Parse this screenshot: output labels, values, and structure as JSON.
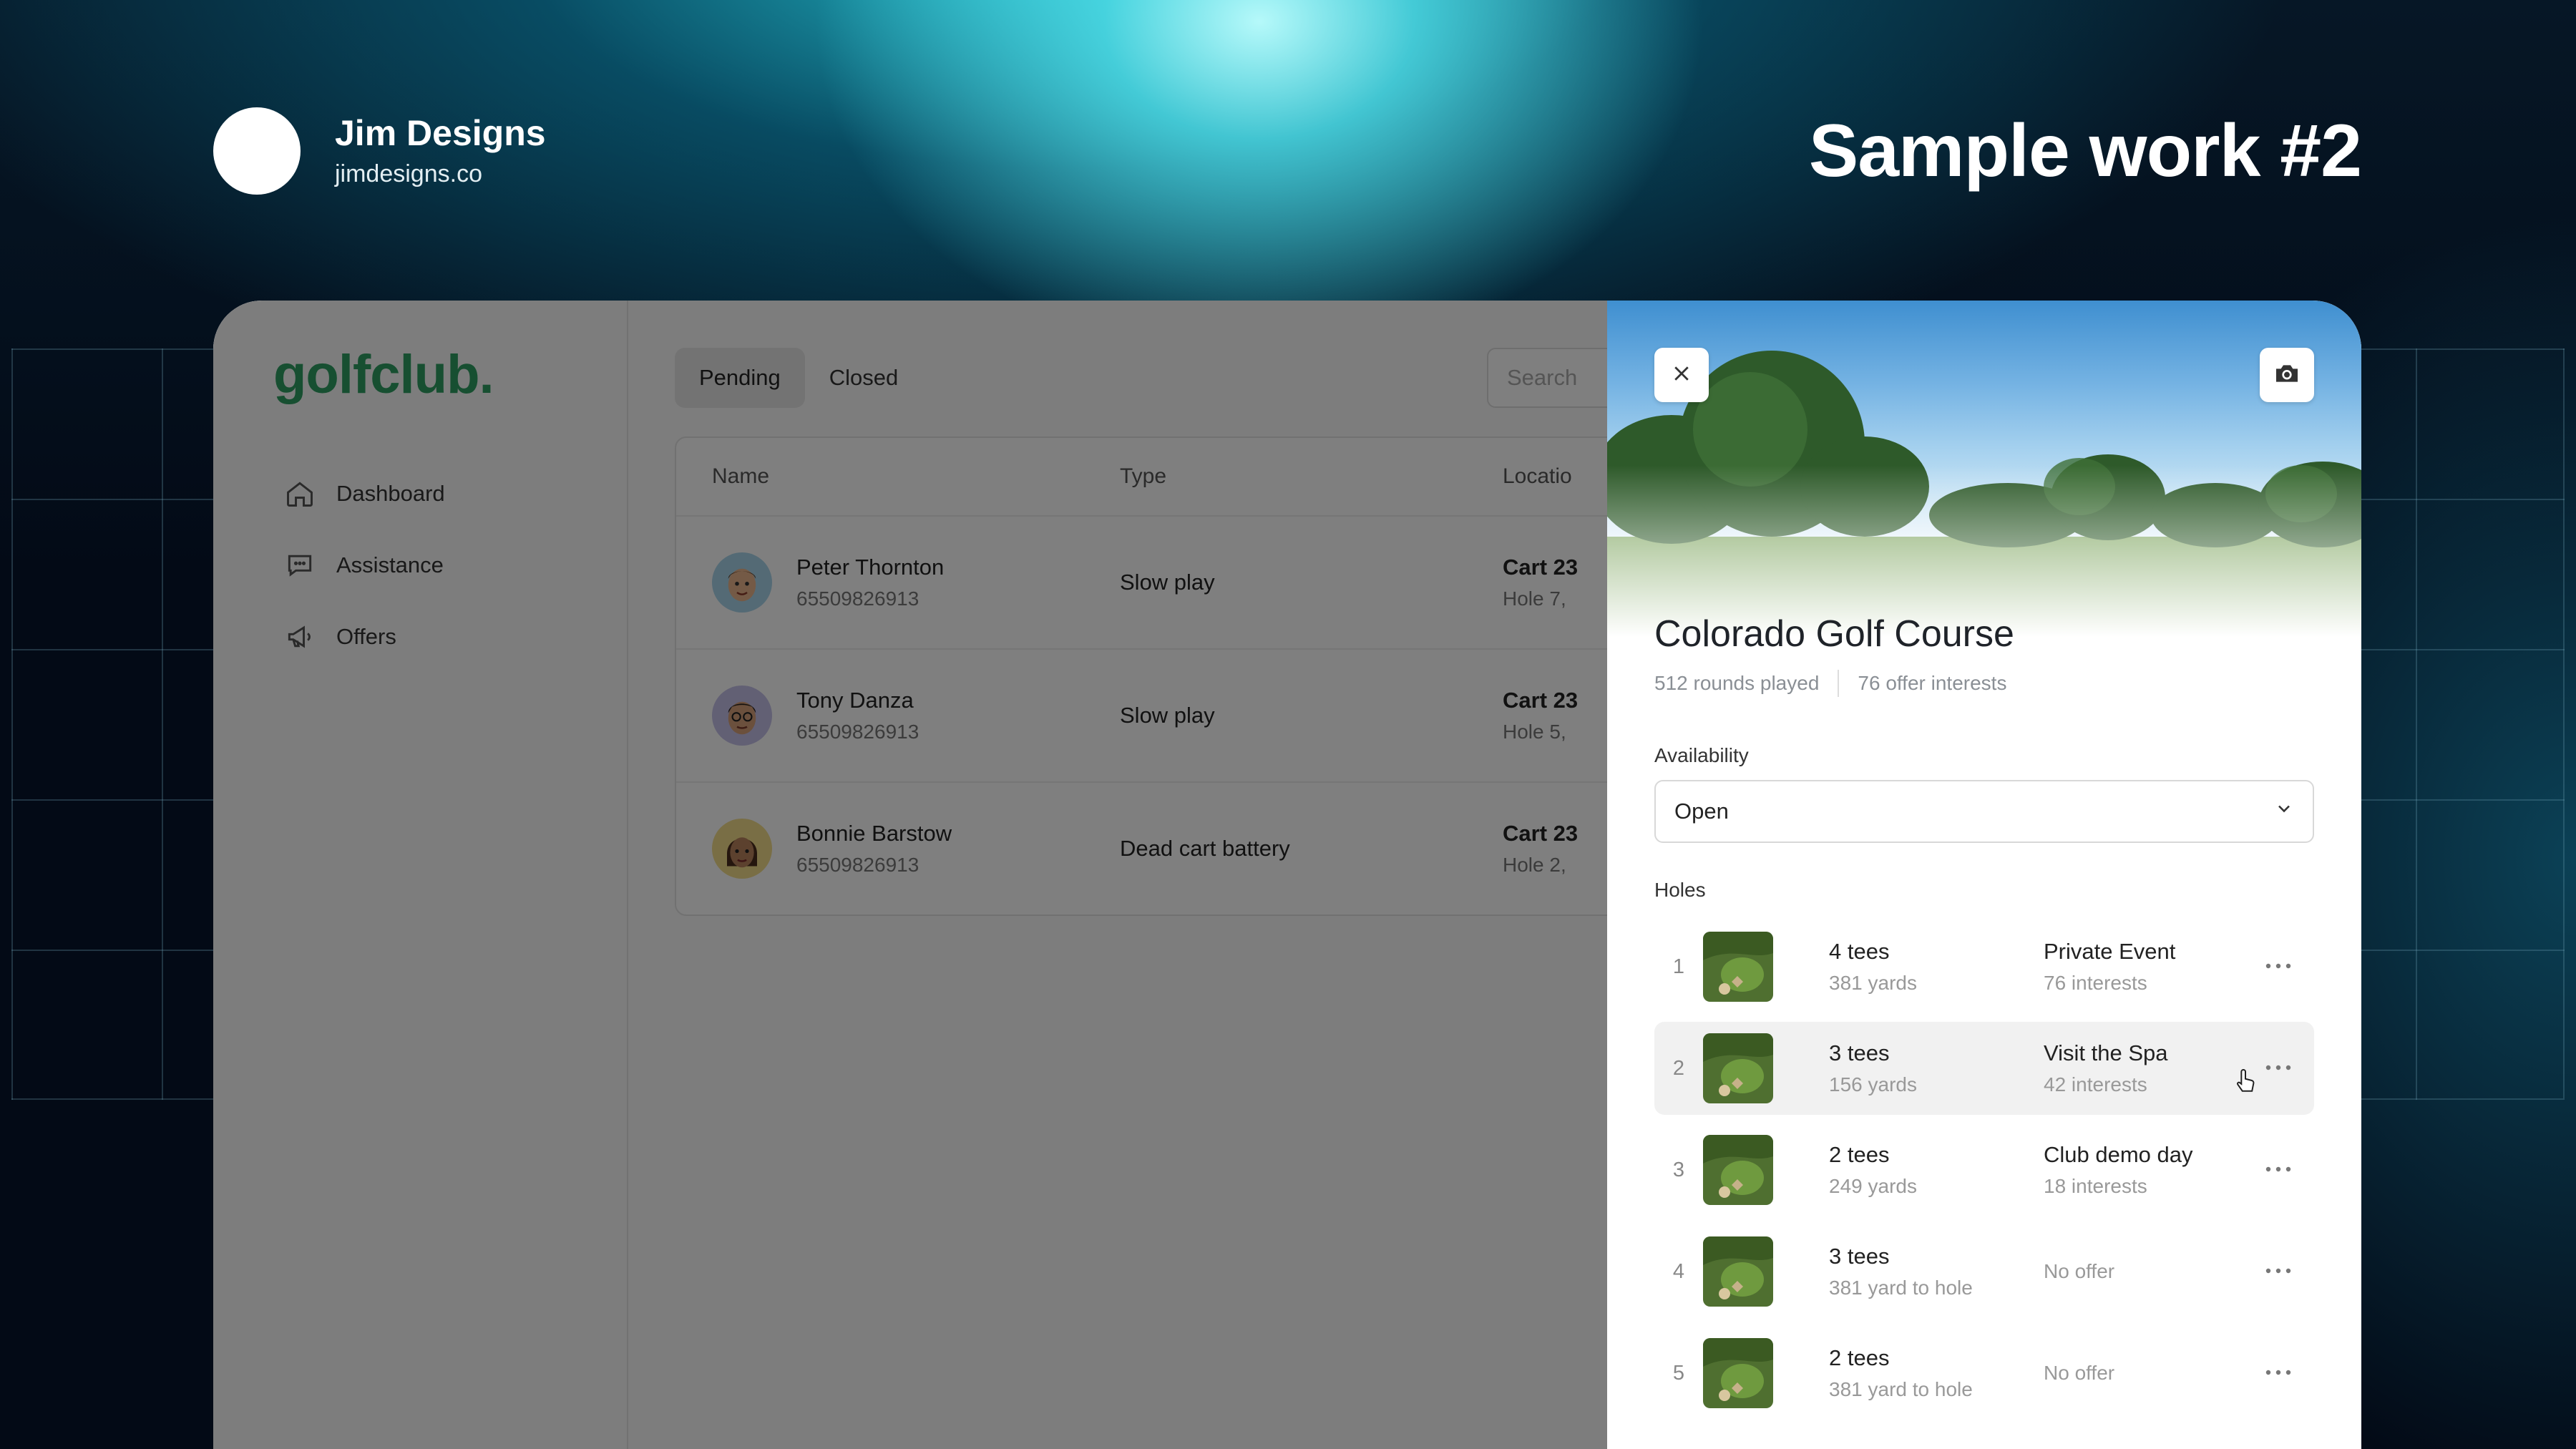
{
  "header": {
    "brand_name": "Jim Designs",
    "brand_url": "jimdesigns.co",
    "sample_title": "Sample work #2"
  },
  "app": {
    "logo": "golfclub.",
    "nav": [
      {
        "label": "Dashboard",
        "icon": "home-icon"
      },
      {
        "label": "Assistance",
        "icon": "chat-icon"
      },
      {
        "label": "Offers",
        "icon": "megaphone-icon"
      }
    ],
    "tabs": [
      {
        "label": "Pending",
        "active": true
      },
      {
        "label": "Closed",
        "active": false
      }
    ],
    "search_placeholder": "Search",
    "table": {
      "headers": {
        "name": "Name",
        "type": "Type",
        "location": "Locatio"
      },
      "rows": [
        {
          "name": "Peter Thornton",
          "phone": "65509826913",
          "type": "Slow play",
          "location": "Cart 23",
          "sub": "Hole 7,"
        },
        {
          "name": "Tony Danza",
          "phone": "65509826913",
          "type": "Slow play",
          "location": "Cart 23",
          "sub": "Hole 5,"
        },
        {
          "name": "Bonnie Barstow",
          "phone": "65509826913",
          "type": "Dead cart battery",
          "location": "Cart 23",
          "sub": "Hole 2,"
        }
      ]
    }
  },
  "panel": {
    "title": "Colorado Golf Course",
    "rounds": "512 rounds played",
    "interests": "76 offer interests",
    "availability_label": "Availability",
    "availability_value": "Open",
    "holes_label": "Holes",
    "holes": [
      {
        "num": "1",
        "tees": "4 tees",
        "yards": "381 yards",
        "offer": "Private Event",
        "offer_interests": "76 interests"
      },
      {
        "num": "2",
        "tees": "3 tees",
        "yards": "156 yards",
        "offer": "Visit the Spa",
        "offer_interests": "42 interests"
      },
      {
        "num": "3",
        "tees": "2 tees",
        "yards": "249 yards",
        "offer": "Club demo day",
        "offer_interests": "18 interests"
      },
      {
        "num": "4",
        "tees": "3 tees",
        "yards": "381 yard to hole",
        "no_offer": "No offer"
      },
      {
        "num": "5",
        "tees": "2 tees",
        "yards": "381 yard to hole",
        "no_offer": "No offer"
      }
    ]
  }
}
